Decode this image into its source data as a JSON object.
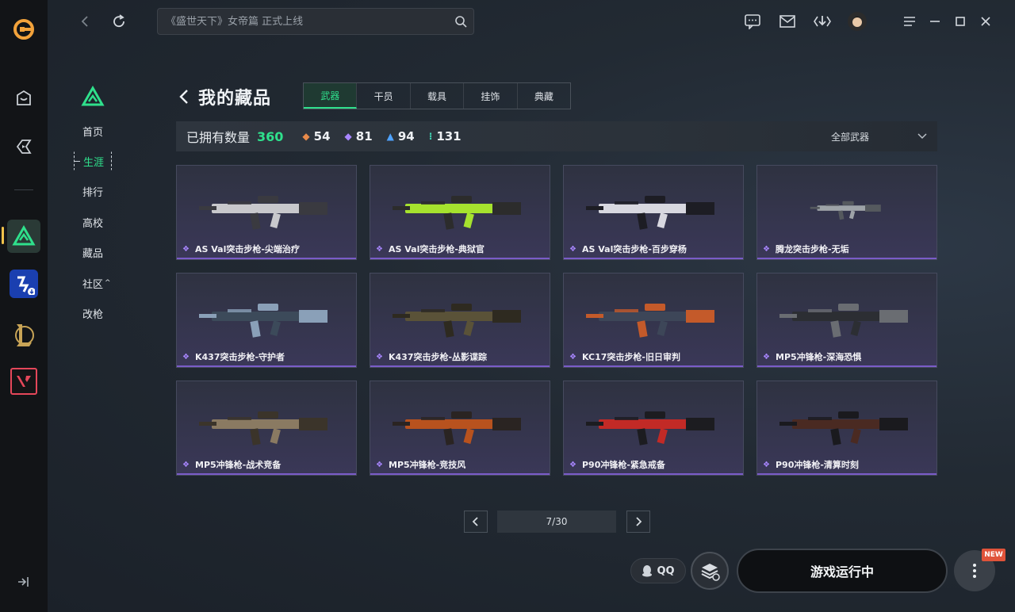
{
  "colors": {
    "accent": "#2fe08c",
    "rail_active": "#f2c34b",
    "rarity_purple": "#a886ff",
    "rarity_orange": "#e88a4a",
    "rarity_blue": "#4fa3ff",
    "rarity_teal": "#3fd0b0",
    "new_badge": "#e0533a"
  },
  "topbar": {
    "search_placeholder": "《盛世天下》女帝篇 正式上线",
    "icons": [
      "back-icon",
      "refresh-icon",
      "search-icon",
      "chat-icon",
      "mail-icon",
      "download-icon",
      "avatar",
      "menu-icon",
      "minimize-icon",
      "maximize-icon",
      "close-icon"
    ]
  },
  "rail": {
    "icons": [
      "app-logo",
      "store-icon",
      "accelerator-icon",
      "delta-force-icon",
      "game-4-icon",
      "league-of-legends-icon",
      "valorant-icon",
      "collapse-sidebar-icon"
    ]
  },
  "subnav": {
    "items": [
      {
        "label": "首页"
      },
      {
        "label": "生涯"
      },
      {
        "label": "排行"
      },
      {
        "label": "高校"
      },
      {
        "label": "藏品"
      },
      {
        "label": "社区"
      },
      {
        "label": "改枪"
      }
    ],
    "active_index": 1
  },
  "header": {
    "title": "我的藏品",
    "tabs": [
      "武器",
      "干员",
      "载具",
      "挂饰",
      "典藏"
    ],
    "active_tab": 0
  },
  "stats": {
    "label": "已拥有数量",
    "total": "360",
    "counts": [
      {
        "value": "54",
        "icon": "orange-diamond-icon",
        "color": "#e88a4a"
      },
      {
        "value": "81",
        "icon": "purple-diamond-icon",
        "color": "#a886ff"
      },
      {
        "value": "94",
        "icon": "blue-diamond-icon",
        "color": "#4fa3ff"
      },
      {
        "value": "131",
        "icon": "teal-diamond-icon",
        "color": "#3fd0b0"
      }
    ],
    "filter_label": "全部武器"
  },
  "items": [
    {
      "name": "AS Val突击步枪-尖端治疗",
      "rarity": "purple"
    },
    {
      "name": "AS Val突击步枪-典狱官",
      "rarity": "purple"
    },
    {
      "name": "AS Val突击步枪-百步穿杨",
      "rarity": "purple"
    },
    {
      "name": "腾龙突击步枪-无垢",
      "rarity": "purple"
    },
    {
      "name": "K437突击步枪-守护者",
      "rarity": "purple"
    },
    {
      "name": "K437突击步枪-丛影谍踪",
      "rarity": "purple"
    },
    {
      "name": "KC17突击步枪-旧日审判",
      "rarity": "purple"
    },
    {
      "name": "MP5冲锋枪-深海恐惧",
      "rarity": "purple"
    },
    {
      "name": "MP5冲锋枪-战术竞备",
      "rarity": "purple"
    },
    {
      "name": "MP5冲锋枪-竞技风",
      "rarity": "purple"
    },
    {
      "name": "P90冲锋枪-紧急戒备",
      "rarity": "purple"
    },
    {
      "name": "P90冲锋枪-清算时刻",
      "rarity": "purple"
    }
  ],
  "pagination": {
    "indicator": "7/30"
  },
  "bottom": {
    "qq_label": "QQ",
    "run_label": "游戏运行中",
    "new_badge": "NEW"
  }
}
